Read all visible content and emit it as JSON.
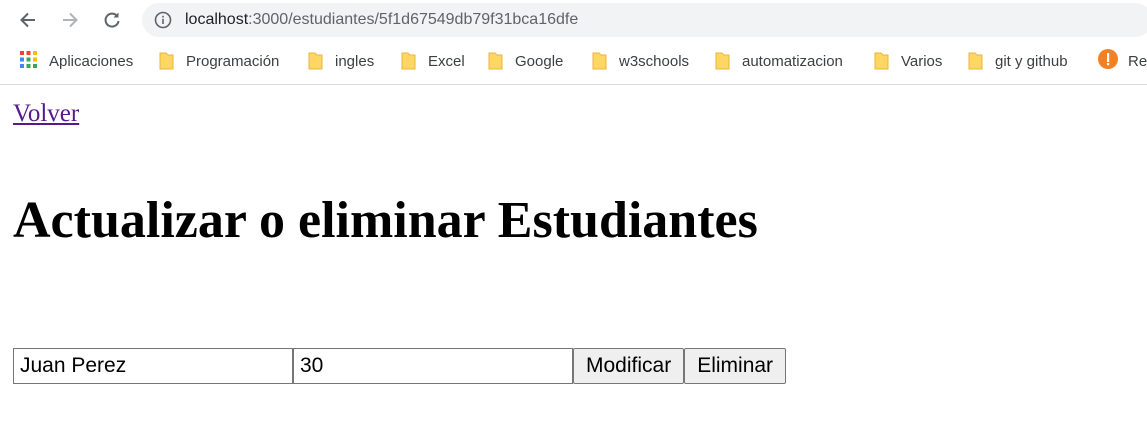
{
  "browser": {
    "url_host": "localhost",
    "url_path": ":3000/estudiantes/5f1d67549db79f31bca16dfe",
    "bookmarks": [
      {
        "label": "Aplicaciones",
        "icon": "apps-grid-icon"
      },
      {
        "label": "Programación",
        "icon": "folder-icon"
      },
      {
        "label": "ingles",
        "icon": "folder-icon"
      },
      {
        "label": "Excel",
        "icon": "folder-icon"
      },
      {
        "label": "Google",
        "icon": "folder-icon"
      },
      {
        "label": "w3schools",
        "icon": "folder-icon"
      },
      {
        "label": "automatizacion",
        "icon": "folder-icon"
      },
      {
        "label": "Varios",
        "icon": "folder-icon"
      },
      {
        "label": "git y github",
        "icon": "folder-icon"
      },
      {
        "label": "Re",
        "icon": "orange-site-icon"
      }
    ]
  },
  "page": {
    "back_link": "Volver",
    "title": "Actualizar o eliminar Estudiantes",
    "form": {
      "name_value": "Juan Perez",
      "age_value": "30",
      "modify_label": "Modificar",
      "delete_label": "Eliminar"
    }
  },
  "colors": {
    "link_visited": "#551a8b",
    "folder": "#fdd663",
    "omnibox_bg": "#f1f3f4"
  }
}
